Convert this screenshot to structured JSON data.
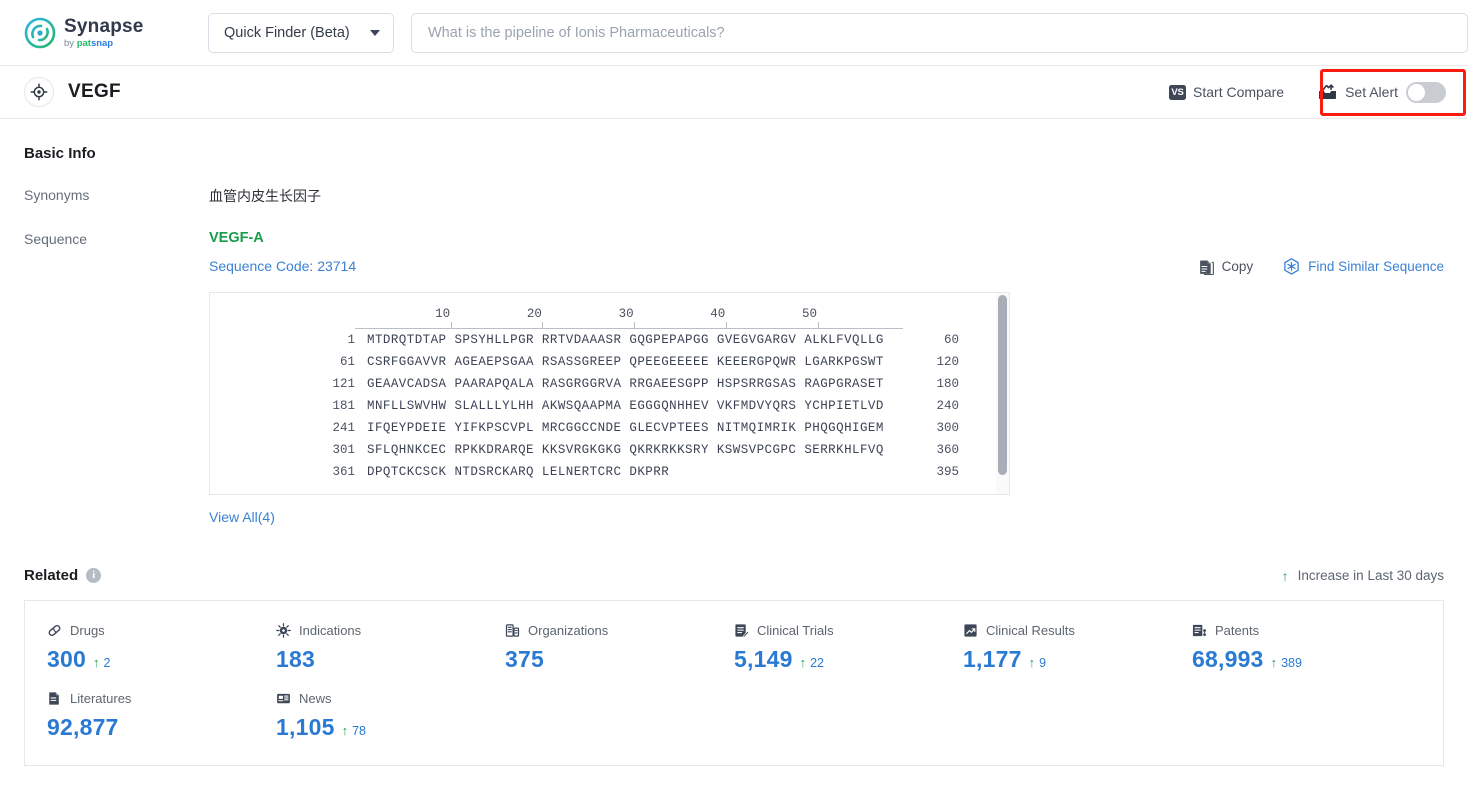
{
  "brand": {
    "name": "Synapse",
    "by": "by ",
    "by_pat": "pat",
    "by_snap": "snap",
    "logo_icon": "synapse-swirl-icon"
  },
  "topbar": {
    "finder_label": "Quick Finder (Beta)",
    "finder_caret_icon": "chevron-down-icon",
    "search_placeholder": "What is the pipeline of Ionis Pharmaceuticals?",
    "search_value": ""
  },
  "entity": {
    "icon": "target-icon",
    "title": "VEGF",
    "compare_label": "Start Compare",
    "compare_badge": "VS",
    "alert_label": "Set Alert",
    "alert_icon": "alert-inbox-icon",
    "alert_toggle_state": "off",
    "highlight_color": "#fb1b10"
  },
  "basic_info": {
    "heading": "Basic Info",
    "rows": [
      {
        "label": "Synonyms",
        "value": "血管内皮生长因子"
      },
      {
        "label": "Sequence",
        "value": ""
      }
    ]
  },
  "sequence": {
    "name": "VEGF-A",
    "code_label": "Sequence Code: 23714",
    "copy_label": "Copy",
    "copy_icon": "copy-icon",
    "similar_label": "Find Similar Sequence",
    "similar_icon": "hexagon-star-icon",
    "ruler_ticks": [
      "10",
      "20",
      "30",
      "40",
      "50"
    ],
    "lines": [
      {
        "start": "1",
        "residues": "MTDRQTDTAP SPSYHLLPGR RRTVDAAASR GQGPEPAPGG GVEGVGARGV ALKLFVQLLG",
        "end": "60"
      },
      {
        "start": "61",
        "residues": "CSRFGGAVVR AGEAEPSGAA RSASSGREEP QPEEGEEEEE KEEERGPQWR LGARKPGSWT",
        "end": "120"
      },
      {
        "start": "121",
        "residues": "GEAAVCADSA PAARAPQALA RASGRGGRVA RRGAEESGPP HSPSRRGSAS RAGPGRASET",
        "end": "180"
      },
      {
        "start": "181",
        "residues": "MNFLLSWVHW SLALLLYLHH AKWSQAAPMA EGGGQNHHEV VKFMDVYQRS YCHPIETLVD",
        "end": "240"
      },
      {
        "start": "241",
        "residues": "IFQEYPDEIE YIFKPSCVPL MRCGGCCNDE GLECVPTEES NITMQIMRIK PHQGQHIGEM",
        "end": "300"
      },
      {
        "start": "301",
        "residues": "SFLQHNKCEC RPKKDRARQE KKSVRGKGKG QKRKRKKSRY KSWSVPCGPC SERRKHLFVQ",
        "end": "360"
      },
      {
        "start": "361",
        "residues": "DPQTCKCSCK NTDSRCKARQ LELNERTCRC DKPRR",
        "end": "395"
      }
    ],
    "view_all": "View All(4)"
  },
  "related": {
    "title": "Related",
    "info_icon": "info-icon",
    "info_glyph": "i",
    "legend_text": "Increase in Last 30 days",
    "legend_arrow": "↑",
    "stats": [
      {
        "label": "Drugs",
        "icon": "pill-icon",
        "value": "300",
        "delta": "2"
      },
      {
        "label": "Indications",
        "icon": "virus-icon",
        "value": "183",
        "delta": ""
      },
      {
        "label": "Organizations",
        "icon": "building-icon",
        "value": "375",
        "delta": ""
      },
      {
        "label": "Clinical Trials",
        "icon": "clinical-trial-icon",
        "value": "5,149",
        "delta": "22"
      },
      {
        "label": "Clinical Results",
        "icon": "clinical-result-icon",
        "value": "1,177",
        "delta": "9"
      },
      {
        "label": "Patents",
        "icon": "patent-icon",
        "value": "68,993",
        "delta": "389"
      },
      {
        "label": "Literatures",
        "icon": "literature-icon",
        "value": "92,877",
        "delta": ""
      },
      {
        "label": "News",
        "icon": "news-icon",
        "value": "1,105",
        "delta": "78"
      }
    ]
  }
}
